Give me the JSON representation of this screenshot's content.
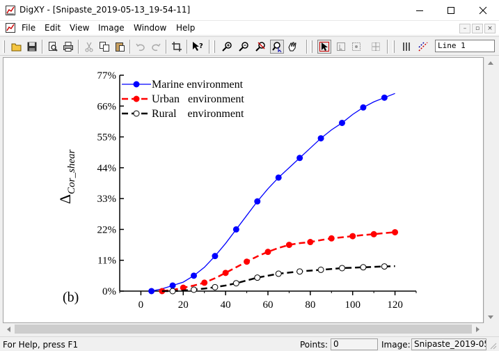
{
  "window": {
    "title": "DigXY - [Snipaste_2019-05-13_19-54-11]"
  },
  "menu": {
    "items": [
      {
        "label": "File"
      },
      {
        "label": "Edit"
      },
      {
        "label": "View"
      },
      {
        "label": "Image"
      },
      {
        "label": "Window"
      },
      {
        "label": "Help"
      }
    ]
  },
  "toolbar": {
    "line_value": "Line 1"
  },
  "statusbar": {
    "help_text": "For Help, press F1",
    "points_label": "Points:",
    "points_value": "0",
    "image_label": "Image:",
    "image_value": "Snipaste_2019-05"
  },
  "chart_data": {
    "type": "line",
    "panel_label": "(b)",
    "ylabel": "Δ",
    "ylabel_sub": "Cor_shear",
    "xlabel": "",
    "xlim": [
      -10,
      130
    ],
    "ylim": [
      0,
      77
    ],
    "xticks": [
      0,
      20,
      40,
      60,
      80,
      100,
      120
    ],
    "yticks": [
      0,
      11,
      22,
      33,
      44,
      55,
      66,
      77
    ],
    "ytick_labels": [
      "0%",
      "11%",
      "22%",
      "33%",
      "44%",
      "55%",
      "66%",
      "77%"
    ],
    "legend_position": "top-left",
    "series": [
      {
        "name": "Marine environment",
        "color": "#0000ff",
        "dash": "solid",
        "marker": "filled",
        "x": [
          5,
          15,
          25,
          35,
          45,
          55,
          65,
          75,
          85,
          95,
          105,
          115
        ],
        "y": [
          0,
          2,
          5.5,
          12.5,
          22,
          32,
          40.5,
          47.5,
          54.5,
          60,
          65.5,
          69
        ],
        "curve_x": [
          5,
          10,
          15,
          20,
          25,
          30,
          35,
          40,
          45,
          50,
          55,
          60,
          65,
          70,
          75,
          80,
          85,
          90,
          95,
          100,
          105,
          110,
          115,
          120
        ],
        "curve_y": [
          0,
          0.8,
          2,
          3.2,
          5.5,
          8.5,
          12.5,
          17,
          22,
          27,
          32,
          36.5,
          40.5,
          44,
          47.5,
          51,
          54.5,
          57.5,
          60,
          63,
          65.5,
          67.5,
          69,
          70.5
        ]
      },
      {
        "name": "Urban   environment",
        "color": "#ff0000",
        "dash": "dashed",
        "marker": "filled",
        "x": [
          10,
          20,
          30,
          40,
          50,
          60,
          70,
          80,
          90,
          100,
          110,
          120
        ],
        "y": [
          0,
          1.2,
          3,
          6.5,
          10.5,
          14,
          16.5,
          17.5,
          18.8,
          19.6,
          20.3,
          21
        ],
        "curve_x": [
          10,
          15,
          20,
          25,
          30,
          35,
          40,
          45,
          50,
          55,
          60,
          65,
          70,
          75,
          80,
          85,
          90,
          95,
          100,
          105,
          110,
          115,
          120
        ],
        "curve_y": [
          0,
          0.4,
          1.2,
          2,
          3,
          4.6,
          6.5,
          8.5,
          10.5,
          12.4,
          14,
          15.4,
          16.5,
          17.1,
          17.5,
          18.2,
          18.8,
          19.2,
          19.6,
          20,
          20.3,
          20.7,
          21
        ]
      },
      {
        "name": "Rural    environment",
        "color": "#000000",
        "dash": "dashed",
        "marker": "open",
        "x": [
          15,
          25,
          35,
          45,
          55,
          65,
          75,
          85,
          95,
          105,
          115
        ],
        "y": [
          0,
          0.5,
          1.4,
          2.8,
          4.8,
          6.2,
          7,
          7.6,
          8.2,
          8.5,
          8.8
        ],
        "curve_x": [
          10,
          15,
          20,
          25,
          30,
          35,
          40,
          45,
          50,
          55,
          60,
          65,
          70,
          75,
          80,
          85,
          90,
          95,
          100,
          105,
          110,
          115,
          120
        ],
        "curve_y": [
          0,
          0,
          0.2,
          0.5,
          0.9,
          1.4,
          2,
          2.8,
          3.8,
          4.8,
          5.5,
          6.2,
          6.6,
          7,
          7.3,
          7.6,
          7.9,
          8.2,
          8.35,
          8.5,
          8.65,
          8.8,
          8.9
        ]
      }
    ]
  }
}
